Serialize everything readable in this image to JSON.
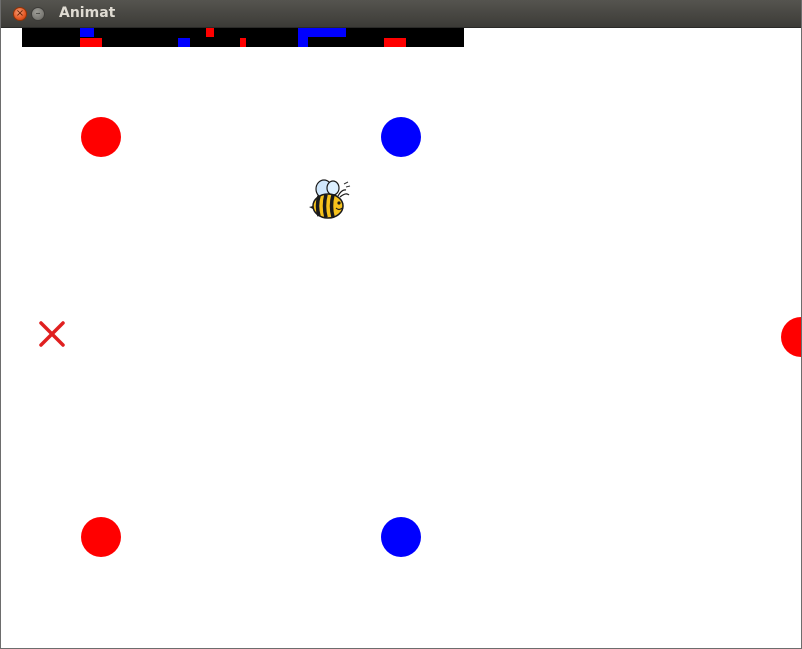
{
  "window": {
    "title": "Animat"
  },
  "colors": {
    "red": "#ff0000",
    "blue": "#0000ff",
    "strip_background": "#000000",
    "canvas_background": "#ffffff",
    "goal_marker": "#e02020"
  },
  "icons": {
    "close": "close-icon",
    "minimize": "minimize-icon",
    "agent": "bee-icon",
    "goal": "x-mark-icon"
  }
}
